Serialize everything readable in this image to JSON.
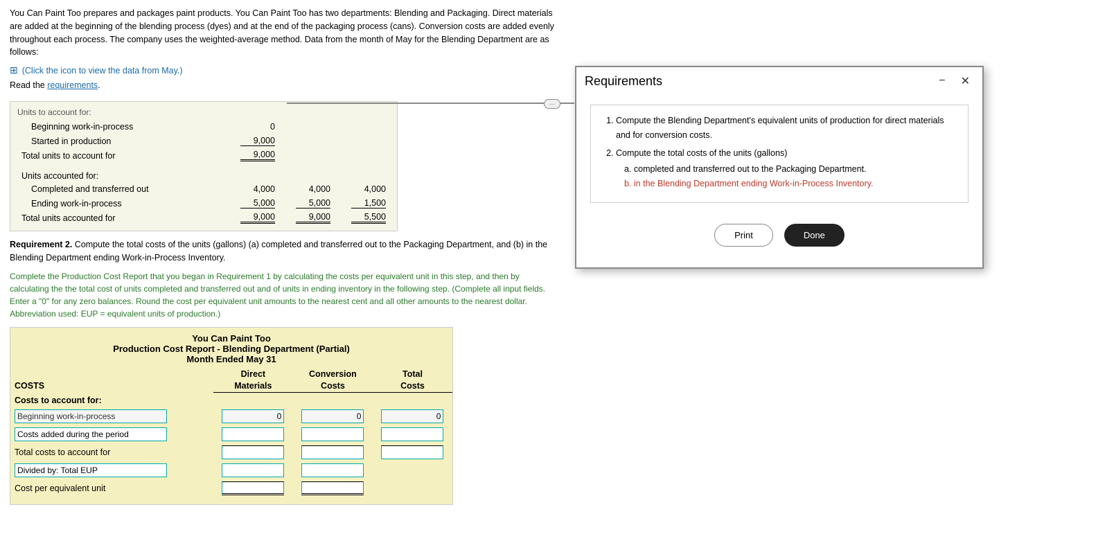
{
  "intro": {
    "text": "You Can Paint Too prepares and packages paint products. You Can Paint Too has two departments: Blending and Packaging. Direct materials are added at the beginning of the blending process (dyes) and at the end of the packaging process (cans). Conversion costs are added evenly throughout each process. The company uses the weighted-average method. Data from the month of May for the Blending Department are as follows:",
    "click_link": "(Click the icon to view the data from May.)",
    "read_label": "Read the",
    "requirements_link": "requirements",
    "read_period": "."
  },
  "units_table": {
    "section1_label": "Units to account for:",
    "rows1": [
      {
        "label": "Beginning work-in-process",
        "value": "0"
      },
      {
        "label": "Started in production",
        "value": "9,000"
      }
    ],
    "total1_label": "Total units to account for",
    "total1_value": "9,000",
    "section2_label": "Units accounted for:",
    "rows2": [
      {
        "label": "Completed and transferred out",
        "col1": "4,000",
        "col2": "4,000",
        "col3": "4,000"
      },
      {
        "label": "Ending work-in-process",
        "col1": "5,000",
        "col2": "5,000",
        "col3": "1,500"
      }
    ],
    "total2_label": "Total units accounted for",
    "total2_col1": "9,000",
    "total2_col2": "9,000",
    "total2_col3": "5,500"
  },
  "req2": {
    "bold_part": "Requirement 2.",
    "text": " Compute the total costs of the units (gallons) (a) completed and transferred out to the Packaging Department, and (b) in the Blending Department ending Work-in-Process Inventory."
  },
  "instruction": {
    "text": "Complete the Production Cost Report that you began in Requirement 1 by calculating the costs per equivalent unit in this step, and then by calculating the the total cost of units completed and transferred out and of units in ending inventory in the following step. (Complete all input fields. Enter a \"0\" for any zero balances. Round the cost per equivalent unit amounts to the nearest cent and all other amounts to the nearest dollar. Abbreviation used: EUP = equivalent units of production.)"
  },
  "report": {
    "company": "You Can Paint Too",
    "title": "Production Cost Report - Blending Department (Partial)",
    "date": "Month Ended May 31",
    "col_header1": "Direct",
    "col_header2": "Conversion",
    "col_header3": "Total",
    "col_sub1": "Materials",
    "col_sub2": "Costs",
    "col_sub3": "Costs",
    "costs_label": "COSTS",
    "costs_to_account_label": "Costs to account for:",
    "rows": [
      {
        "label": "Beginning work-in-process",
        "val1": "0",
        "val2": "0",
        "val3": "0",
        "readonly": true
      },
      {
        "label": "Costs added during the period",
        "val1": "",
        "val2": "",
        "val3": "",
        "readonly": false
      }
    ],
    "total_costs_label": "Total costs to account for",
    "divided_label": "Divided by: Total EUP",
    "cost_per_unit_label": "Cost per equivalent unit"
  },
  "modal": {
    "title": "Requirements",
    "minimize_label": "−",
    "close_label": "✕",
    "connector_dots": "···",
    "items": [
      {
        "number": "1.",
        "text": "Compute the Blending Department's equivalent units of production for direct materials and for conversion costs."
      },
      {
        "number": "2.",
        "text": "Compute the total costs of the units (gallons)",
        "sub_items": [
          "a. completed and transferred out to the Packaging Department.",
          "b. in the Blending Department ending Work-in-Process Inventory."
        ]
      }
    ],
    "print_label": "Print",
    "done_label": "Done"
  }
}
